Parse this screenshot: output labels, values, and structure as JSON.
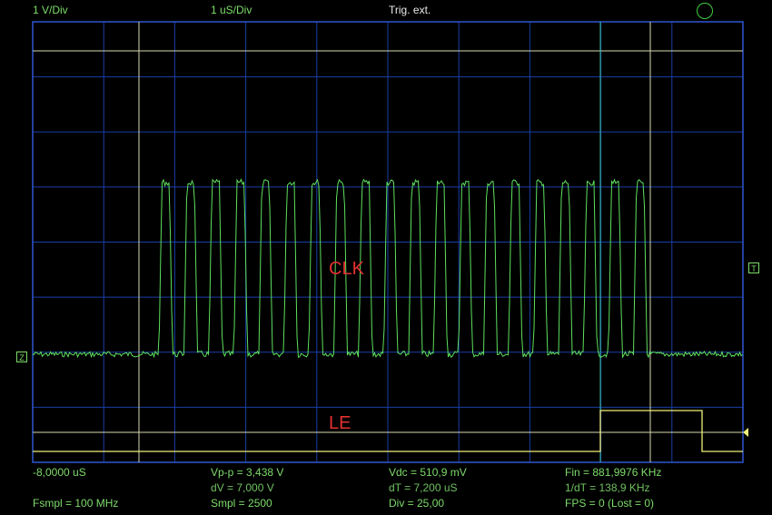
{
  "header": {
    "volts_div": "1 V/Div",
    "time_div": "1 uS/Div",
    "trigger": "Trig.  ext."
  },
  "channels": {
    "clk_label": "CLK",
    "le_label": "LE",
    "ground_marker": "Z",
    "trigger_marker": "T"
  },
  "readouts": {
    "row1": [
      "-8,0000 uS",
      "Vp-p = 3,438 V",
      "Vdc = 510,9 mV",
      "Fin = 881,9976 KHz"
    ],
    "row2": [
      "",
      "dV = 7,000 V",
      "dT = 7,200 uS",
      "1/dT = 138,9 KHz"
    ],
    "row3": [
      "Fsmpl = 100 MHz",
      "Smpl = 2500",
      "Div = 25,00",
      "FPS = 0 (Lost = 0)"
    ]
  },
  "colors": {
    "grid": "#1a3ea8",
    "frame": "#2f56d0",
    "clk_trace": "#5ee05e",
    "le_trace": "#f0f07a",
    "cursor": "#d8d8b0",
    "label_red": "#e33030"
  }
}
